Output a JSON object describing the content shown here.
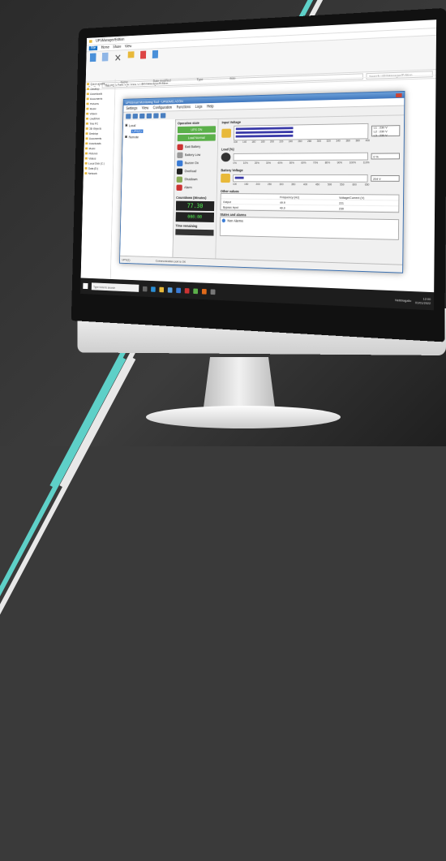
{
  "explorer": {
    "window_title": "UPSManager/Edition",
    "tabs": [
      "File",
      "Home",
      "Share",
      "View"
    ],
    "address": "This PC > Data > pc.zone > UPSSManager/Edition",
    "search_placeholder": "Search UPSManager/Edition",
    "columns": [
      "Name",
      "Date modified",
      "Type",
      "Size"
    ],
    "nav_items": [
      "Quick access",
      "Desktop",
      "Downloads",
      "Documents",
      "Pictures",
      "Music",
      "Videos",
      "OneDrive",
      "This PC",
      "3D Objects",
      "Desktop",
      "Documents",
      "Downloads",
      "Music",
      "Pictures",
      "Videos",
      "Local Disk (C:)",
      "Data (D:)",
      "Network"
    ]
  },
  "taskbar": {
    "search_placeholder": "Type here to search",
    "tray_text": "Nebbiagallo",
    "time": "12:00",
    "date": "01/01/2022"
  },
  "ups": {
    "title": "UPSSmart Monitoring Tool - UPSDMS.ACON",
    "menu": [
      "Settings",
      "View",
      "Configuration",
      "Functions",
      "Logs",
      "Help"
    ],
    "tree": {
      "root": "Local",
      "selected": "UPS(1)",
      "remote": "Remote"
    },
    "mid": {
      "header": "Operation state",
      "status1": "UPS ON",
      "status2": "Load Normal",
      "batt_label": "Batt Battery",
      "controls": [
        "Battery Low",
        "Buzzer On",
        "Overload",
        "Shutdown",
        "Alarm"
      ],
      "countdown_label": "Countdown (Minutes)",
      "lcd_value": "77.30",
      "lcd_value2": "000:00",
      "time_remaining_label": "Time remaining"
    },
    "input_voltage": {
      "title": "Input Voltage",
      "ticks": [
        "100",
        "140",
        "160",
        "180",
        "200",
        "220",
        "240",
        "260",
        "280",
        "300",
        "320",
        "340",
        "360",
        "380",
        "400"
      ],
      "readouts": [
        "L1 : 230 V",
        "L2 : 230 V",
        "L3 : 230 V"
      ],
      "fills": [
        0.45,
        0.45,
        0.45
      ]
    },
    "load": {
      "title": "Load (%)",
      "ticks": [
        "0%",
        "10%",
        "20%",
        "30%",
        "40%",
        "50%",
        "60%",
        "70%",
        "80%",
        "90%",
        "100%",
        "110%"
      ],
      "readout": "0 %",
      "fill": 0.0
    },
    "battery_voltage": {
      "title": "Battery Voltage",
      "ticks": [
        "100",
        "150",
        "200",
        "250",
        "300",
        "350",
        "400",
        "450",
        "500",
        "550",
        "600",
        "650"
      ],
      "readout": "204 V",
      "fill": 0.08
    },
    "other_values": {
      "title": "Other values",
      "header": [
        "",
        "Frequency (Hz)",
        "Voltage/Current (V)"
      ],
      "rows": [
        [
          "Output",
          "49.9",
          "221"
        ],
        [
          "Bypass input",
          "49.9",
          "230"
        ]
      ]
    },
    "alarm": {
      "title": "States and alarms",
      "message": "Non Alarms"
    },
    "status_bar": [
      "UPS(1)",
      "Communication port is OK"
    ]
  },
  "colors": {
    "accent": "#3a7bd5",
    "status_green": "#5bb04a",
    "bar_blue": "#3a3aa8",
    "stripe_teal": "#5ed0c8"
  }
}
